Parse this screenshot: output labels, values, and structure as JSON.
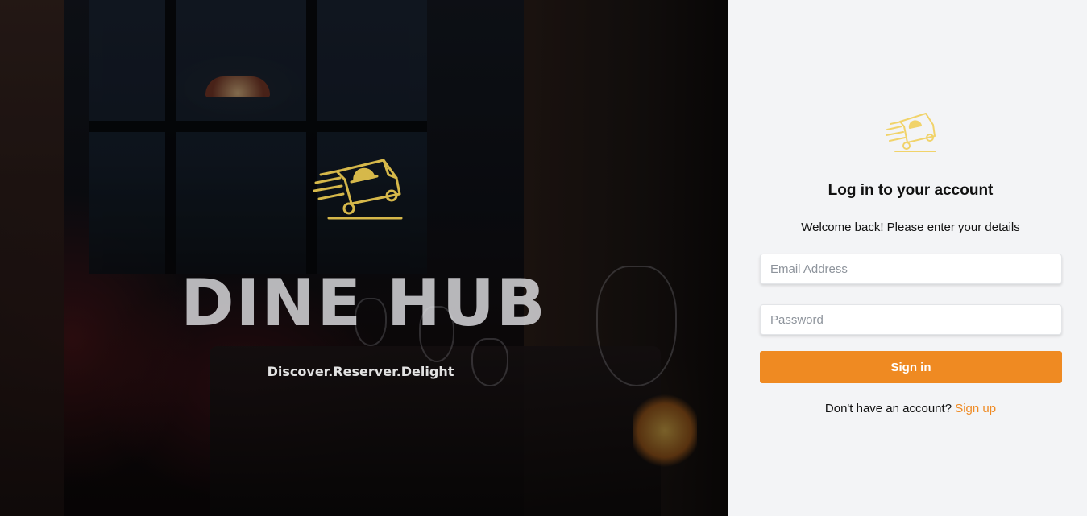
{
  "hero": {
    "brand_name": "DINE HUB",
    "tagline": "Discover.Reserver.Delight",
    "logo_icon": "delivery-truck-icon"
  },
  "login": {
    "logo_icon": "delivery-truck-icon",
    "title": "Log in to your account",
    "subtitle": "Welcome back! Please enter your details",
    "email_placeholder": "Email Address",
    "email_value": "",
    "password_placeholder": "Password",
    "password_value": "",
    "signin_label": "Sign in",
    "signup_prompt": "Don't have an account?",
    "signup_link": "Sign up"
  },
  "colors": {
    "accent": "#ef8a22",
    "logo_gold": "#d6b84a",
    "logo_gold_light": "#f1d36a",
    "panel_bg": "#f3f4f6"
  }
}
